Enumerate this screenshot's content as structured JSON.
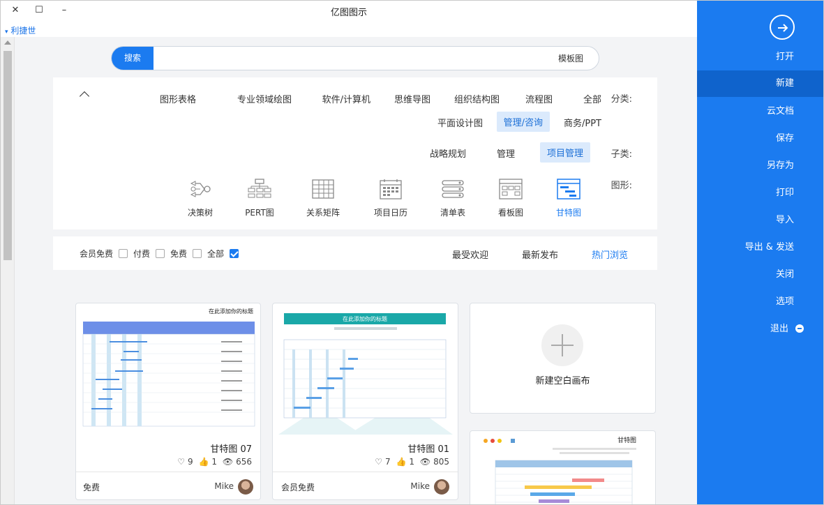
{
  "window": {
    "title": "亿图图示",
    "close": "✕",
    "maximize": "☐",
    "minimize": "–"
  },
  "user": {
    "name": "利捷世"
  },
  "sidebar": {
    "items": [
      {
        "label": "打开"
      },
      {
        "label": "新建"
      },
      {
        "label": "云文档"
      },
      {
        "label": "保存"
      },
      {
        "label": "另存为"
      },
      {
        "label": "打印"
      },
      {
        "label": "导入"
      },
      {
        "label": "导出 & 发送"
      },
      {
        "label": "关闭"
      },
      {
        "label": "选项"
      },
      {
        "label": "退出"
      }
    ],
    "active_color": "#0f63cc",
    "bg_color": "#1b7bf0"
  },
  "search": {
    "button": "搜索",
    "value": "模板图"
  },
  "filter": {
    "category_label": "分类:",
    "categories": [
      "全部",
      "流程图",
      "组织结构图",
      "思维导图",
      "软件/计算机",
      "专业领域绘图",
      "图形表格",
      "商务/PPT",
      "管理/咨询",
      "平面设计图"
    ],
    "selected_category": "管理/咨询",
    "sub_label": "子类:",
    "subs": [
      "项目管理",
      "管理",
      "战略规划"
    ],
    "selected_sub": "项目管理",
    "shape_label": "图形:",
    "shapes": [
      {
        "label": "甘特图",
        "icon": "gantt-icon"
      },
      {
        "label": "看板图",
        "icon": "kanban-icon"
      },
      {
        "label": "清单表",
        "icon": "checklist-icon"
      },
      {
        "label": "项目日历",
        "icon": "calendar-icon"
      },
      {
        "label": "关系矩阵",
        "icon": "matrix-icon"
      },
      {
        "label": "PERT图",
        "icon": "pert-icon"
      },
      {
        "label": "决策树",
        "icon": "decision-tree-icon"
      }
    ],
    "selected_shape": "甘特图"
  },
  "sort": {
    "tabs": [
      "热门浏览",
      "最新发布",
      "最受欢迎"
    ],
    "selected": "热门浏览",
    "checks": [
      {
        "label": "全部",
        "checked": true
      },
      {
        "label": "免费",
        "checked": false
      },
      {
        "label": "付费",
        "checked": false
      },
      {
        "label": "会员免费",
        "checked": false
      }
    ]
  },
  "blank_card": {
    "label": "新建空白画布"
  },
  "templates": [
    {
      "name": "甘特图 01",
      "views": "805",
      "likes": "1",
      "favs": "7",
      "author": "Mike",
      "price": "会员免费",
      "thumb_title": "在此添加你的标题"
    },
    {
      "name": "甘特图 07",
      "views": "656",
      "likes": "1",
      "favs": "9",
      "author": "Mike",
      "price": "免费",
      "thumb_title": "在此添加你的标题"
    },
    {
      "name": "",
      "views": "",
      "likes": "",
      "favs": "",
      "author": "",
      "price": "",
      "thumb_title": "甘特图"
    }
  ],
  "colors": {
    "accent": "#1b7bf0",
    "selected_bg": "#dbeafc"
  }
}
